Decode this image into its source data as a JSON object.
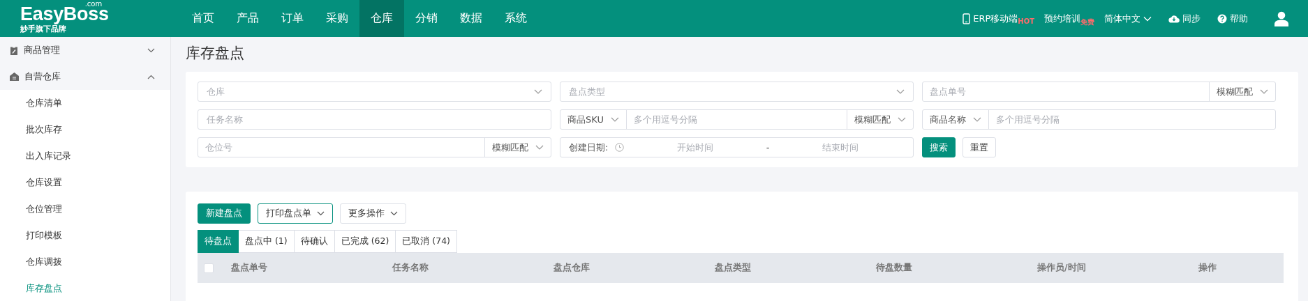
{
  "header": {
    "logo": {
      "brand": "EasyBoss",
      "domain": ".com",
      "tagline": "妙手旗下品牌"
    },
    "menu": [
      {
        "label": "首页",
        "selected": false
      },
      {
        "label": "产品",
        "selected": false
      },
      {
        "label": "订单",
        "selected": false
      },
      {
        "label": "采购",
        "selected": false
      },
      {
        "label": "仓库",
        "selected": true
      },
      {
        "label": "分销",
        "selected": false
      },
      {
        "label": "数据",
        "selected": false
      },
      {
        "label": "系统",
        "selected": false
      }
    ],
    "tools": [
      {
        "kind": "mobile",
        "label": "ERP移动端",
        "badge": "HOT"
      },
      {
        "kind": "training",
        "label": "预约培训",
        "badge": "免费"
      },
      {
        "kind": "language",
        "label": "简体中文"
      },
      {
        "kind": "sync",
        "label": "同步"
      },
      {
        "kind": "help",
        "label": "帮助"
      }
    ]
  },
  "sidebar": {
    "groups": [
      {
        "kind": "goods",
        "label": "商品管理",
        "expanded": false
      },
      {
        "kind": "warehouse",
        "label": "自营仓库",
        "expanded": true,
        "children": [
          {
            "label": "仓库清单",
            "selected": false
          },
          {
            "label": "批次库存",
            "selected": false
          },
          {
            "label": "出入库记录",
            "selected": false
          },
          {
            "label": "仓库设置",
            "selected": false
          },
          {
            "label": "仓位管理",
            "selected": false
          },
          {
            "label": "打印模板",
            "selected": false
          },
          {
            "label": "仓库调拨",
            "selected": false
          },
          {
            "label": "库存盘点",
            "selected": true
          }
        ]
      }
    ]
  },
  "page_title": "库存盘点",
  "filters": [
    {
      "kind": "select",
      "placeholder": "仓库"
    },
    {
      "kind": "select",
      "placeholder": "盘点类型"
    },
    {
      "kind": "input_match",
      "placeholder": "盘点单号",
      "match": "模糊匹配"
    },
    {
      "kind": "input",
      "placeholder": "任务名称"
    },
    {
      "kind": "prefix_input",
      "prefix": "商品SKU",
      "placeholder": "多个用逗号分隔",
      "match": "模糊匹配"
    },
    {
      "kind": "prefix_input",
      "prefix": "商品名称",
      "placeholder": "多个用逗号分隔"
    },
    {
      "kind": "input_match",
      "placeholder": "仓位号",
      "match": "模糊匹配"
    },
    {
      "kind": "date_range",
      "label": "创建日期:",
      "start_placeholder": "开始时间",
      "separator": "-",
      "end_placeholder": "结束时间"
    },
    {
      "kind": "buttons",
      "search": "搜索",
      "reset": "重置"
    }
  ],
  "actions": [
    {
      "kind": "primary",
      "label": "新建盘点"
    },
    {
      "kind": "outline",
      "label": "打印盘点单"
    },
    {
      "kind": "default",
      "label": "更多操作"
    }
  ],
  "tabs": [
    {
      "label": "待盘点",
      "selected": true
    },
    {
      "label": "盘点中 (1)",
      "selected": false
    },
    {
      "label": "待确认",
      "selected": false
    },
    {
      "label": "已完成 (62)",
      "selected": false
    },
    {
      "label": "已取消 (74)",
      "selected": false
    }
  ],
  "table": {
    "select_all_checked": false,
    "columns": [
      "盘点单号",
      "任务名称",
      "盘点仓库",
      "盘点类型",
      "待盘数量",
      "操作员/时间",
      "操作"
    ]
  }
}
